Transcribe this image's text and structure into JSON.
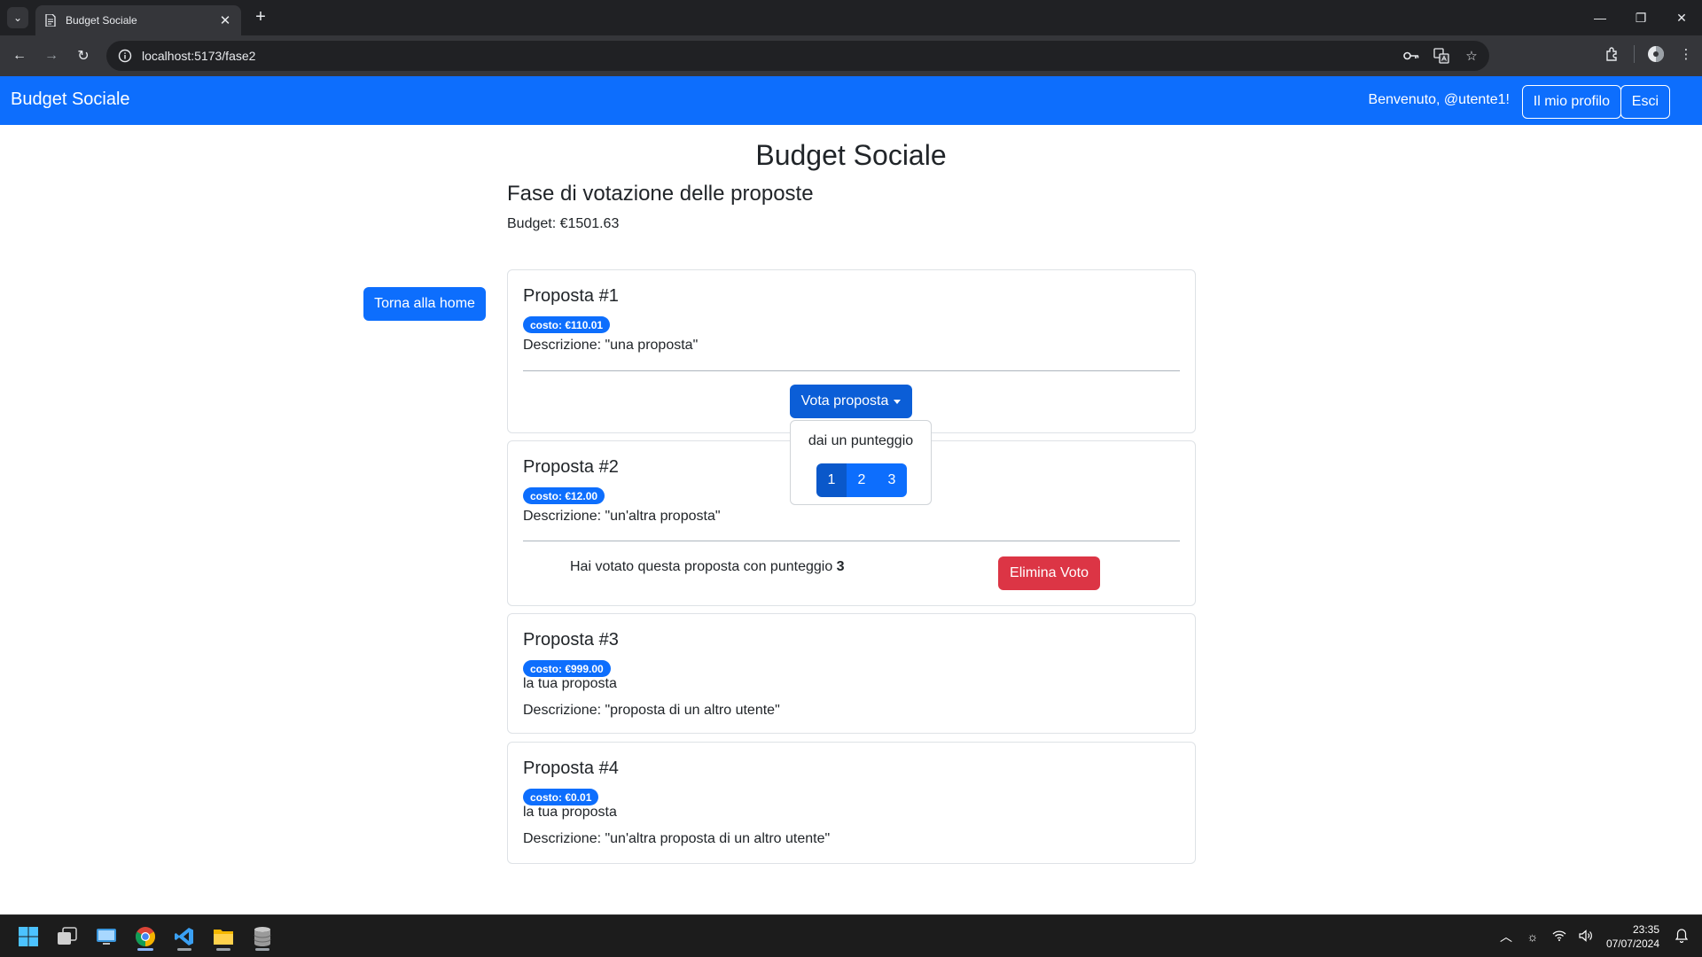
{
  "browser": {
    "tab_title": "Budget Sociale",
    "tab_close": "✕",
    "new_tab": "+",
    "url": "localhost:5173/fase2",
    "window_controls": [
      "—",
      "❐",
      "✕"
    ]
  },
  "navbar": {
    "brand": "Budget Sociale",
    "welcome": "Benvenuto, @utente1!",
    "profile_label": "Il mio profilo",
    "logout_label": "Esci",
    "color": "#0d6efd"
  },
  "main": {
    "title": "Budget Sociale",
    "phase_title": "Fase di votazione delle proposte",
    "budget": "Budget: €1501.63",
    "home_button": "Torna alla home"
  },
  "proposals": [
    {
      "title": "Proposta #1",
      "cost": "costo: €110.01",
      "description": "Descrizione: \"una proposta\"",
      "vote_button": "Vota proposta"
    },
    {
      "title": "Proposta #2",
      "cost": "costo: €12.00",
      "description": "Descrizione: \"un'altra proposta\"",
      "voted_text": "Hai votato questa proposta con punteggio ",
      "voted_score": "3",
      "delete_button": "Elimina Voto"
    },
    {
      "title": "Proposta #3",
      "cost": "costo: €999.00",
      "own_label": "la tua proposta",
      "description": "Descrizione: \"proposta di un altro utente\""
    },
    {
      "title": "Proposta #4",
      "cost": "costo: €0.01",
      "own_label": "la tua proposta",
      "description": "Descrizione: \"un'altra proposta di un altro utente\""
    }
  ],
  "vote_dropdown": {
    "label": "dai un punteggio",
    "scores": [
      "1",
      "2",
      "3"
    ]
  },
  "taskbar": {
    "time": "23:35",
    "date": "07/07/2024"
  },
  "colors": {
    "primary": "#0d6efd",
    "danger": "#dc3545"
  }
}
